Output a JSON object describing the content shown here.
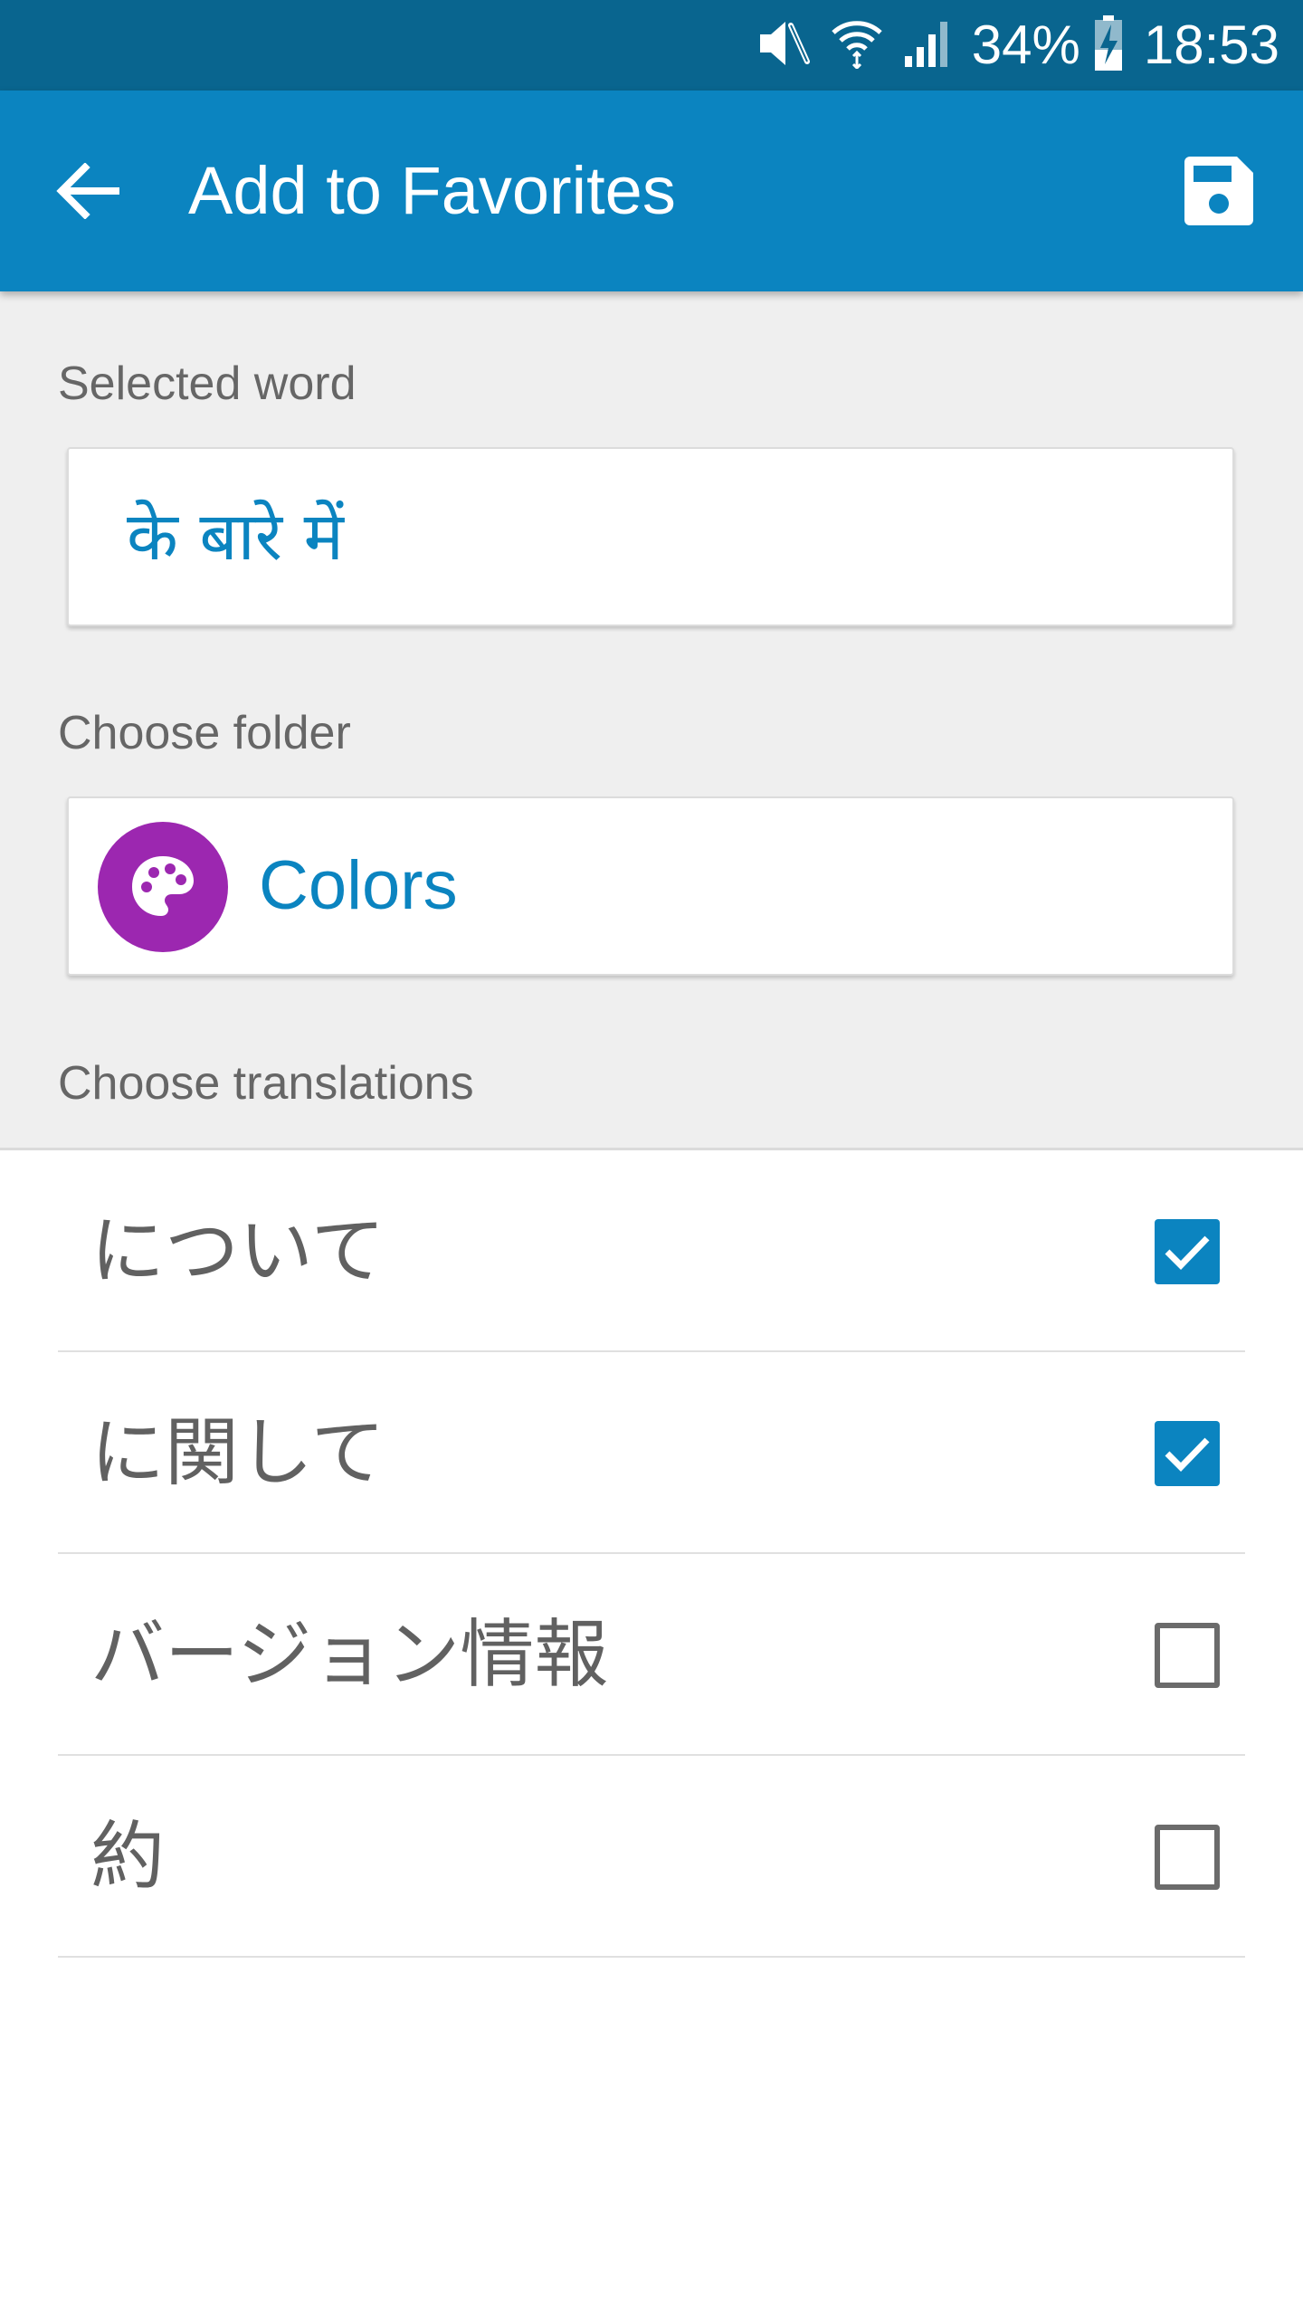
{
  "status_bar": {
    "battery_percent": "34%",
    "time": "18:53",
    "icons": [
      "mute-icon",
      "wifi-icon",
      "signal-icon",
      "battery-charging-icon"
    ]
  },
  "app_bar": {
    "title": "Add to Favorites",
    "back_icon": "arrow-left-icon",
    "save_icon": "floppy-disk-icon"
  },
  "form": {
    "selected_word_label": "Selected word",
    "selected_word": "के बारे में",
    "choose_folder_label": "Choose folder",
    "folder": {
      "name": "Colors",
      "icon": "palette-icon",
      "icon_color": "#9c27b0"
    },
    "choose_translations_label": "Choose translations"
  },
  "translations": [
    {
      "text": "について",
      "checked": true
    },
    {
      "text": "に関して",
      "checked": true
    },
    {
      "text": "バージョン情報",
      "checked": false
    },
    {
      "text": "約",
      "checked": false
    }
  ],
  "colors": {
    "status_bar": "#09658f",
    "app_bar": "#0b84c0",
    "accent": "#0b84c0",
    "form_background": "#efefef"
  }
}
